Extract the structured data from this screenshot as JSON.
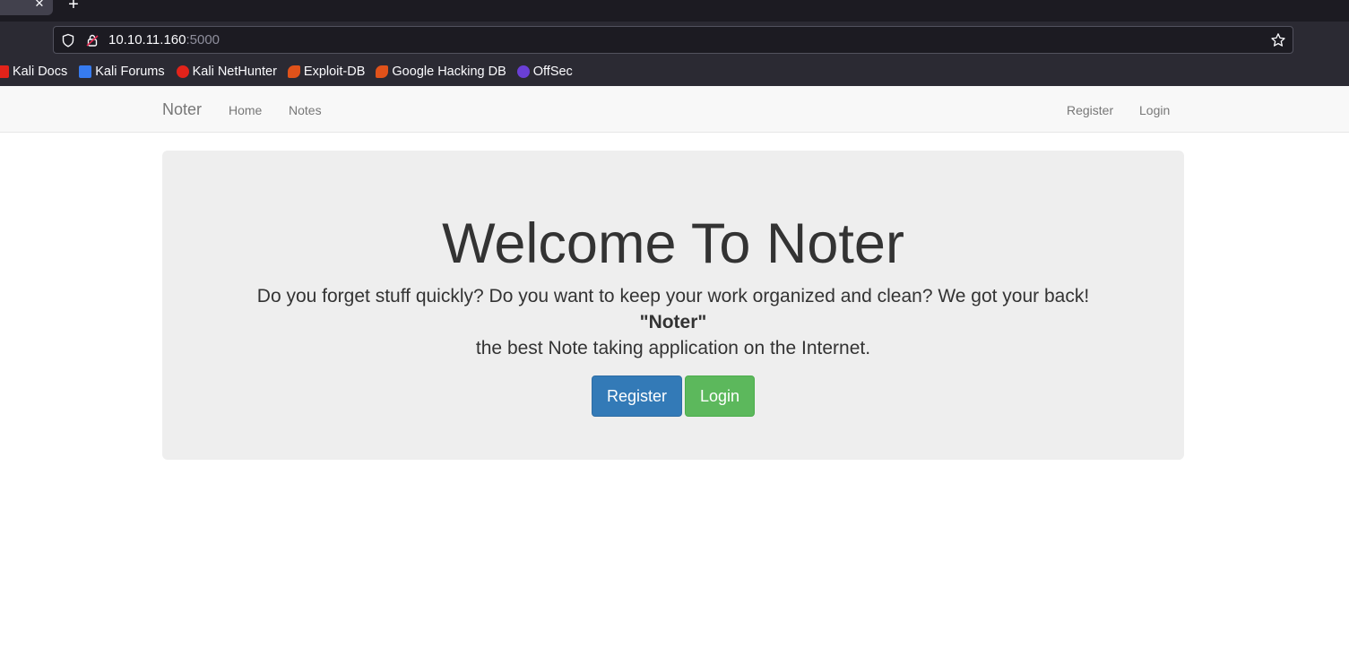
{
  "browser": {
    "tab_close_glyph": "✕",
    "new_tab_glyph": "+",
    "url": {
      "host": "10.10.11.160",
      "port": ":5000"
    },
    "bookmarks": [
      {
        "label": "Kali Docs",
        "icon": "kali-docs-icon",
        "color": "#e2231a"
      },
      {
        "label": "Kali Forums",
        "icon": "kali-forums-icon",
        "color": "#367bf0"
      },
      {
        "label": "Kali NetHunter",
        "icon": "kali-nethunter-icon",
        "color": "#e2231a"
      },
      {
        "label": "Exploit-DB",
        "icon": "exploit-db-icon",
        "color": "#e0521a"
      },
      {
        "label": "Google Hacking DB",
        "icon": "ghdb-icon",
        "color": "#e0521a"
      },
      {
        "label": "OffSec",
        "icon": "offsec-icon",
        "color": "#6a3fd6"
      }
    ]
  },
  "site": {
    "brand": "Noter",
    "nav_left": [
      "Home",
      "Notes"
    ],
    "nav_right": [
      "Register",
      "Login"
    ],
    "hero": {
      "title": "Welcome To Noter",
      "line1": "Do you forget stuff quickly? Do you want to keep your work organized and clean? We got your back!",
      "strong": "\"Noter\"",
      "line2": "the best Note taking application on the Internet.",
      "register_label": "Register",
      "login_label": "Login"
    }
  },
  "colors": {
    "primary": "#337ab7",
    "success": "#5cb85c",
    "jumbotron_bg": "#eeeeee",
    "navbar_bg": "#f8f8f8"
  }
}
